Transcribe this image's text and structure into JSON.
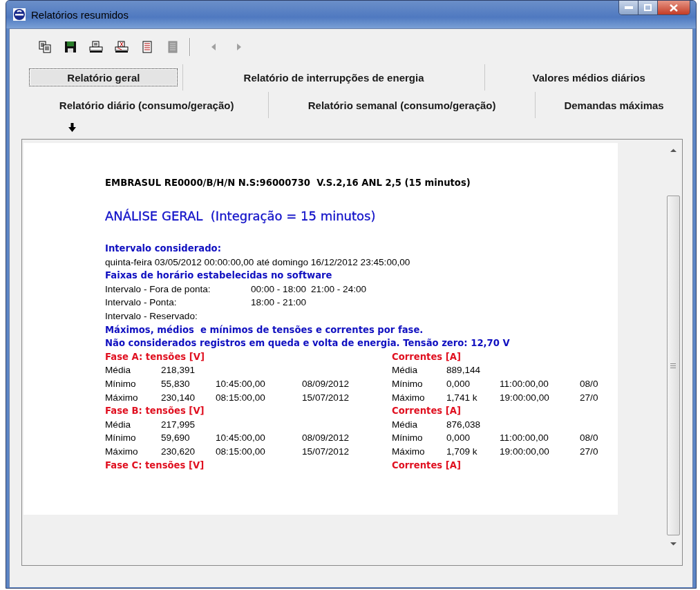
{
  "window": {
    "title": "Relatórios resumidos"
  },
  "toolbar": [
    {
      "kind": "copy",
      "disabled": false
    },
    {
      "kind": "save",
      "disabled": false
    },
    {
      "kind": "print",
      "disabled": false
    },
    {
      "kind": "print-setup",
      "disabled": false
    },
    {
      "kind": "export",
      "disabled": false
    },
    {
      "kind": "export",
      "disabled": true
    },
    {
      "kind": "separator"
    },
    {
      "kind": "prev",
      "disabled": true
    },
    {
      "kind": "next",
      "disabled": true
    }
  ],
  "tab_rows": [
    [
      {
        "label": "Relatório geral",
        "selected": true
      },
      {
        "label": "Relatório de interrupções de energia",
        "selected": false
      },
      {
        "label": "Valores médios diários",
        "selected": false
      }
    ],
    [
      {
        "label": "Relatório diário (consumo/geração)",
        "selected": false
      },
      {
        "label": "Relatório semanal (consumo/geração)",
        "selected": false
      },
      {
        "label": "Demandas máximas",
        "selected": false
      }
    ]
  ],
  "report": [
    {
      "kind": "header",
      "text": "EMBRASUL RE0000/B/H/N N.S:96000730  V.S.2,16 ANL 2,5 (15 minutos)"
    },
    {
      "kind": "title",
      "text": "ANÁLISE GERAL  (Integração = 15 minutos)"
    },
    {
      "kind": "heading",
      "text": "Intervalo considerado:"
    },
    {
      "kind": "text",
      "text": "quinta-feira 03/05/2012 00:00:00,00 até domingo 16/12/2012 23:45:00,00"
    },
    {
      "kind": "heading",
      "text": "Faixas de horário estabelecidas no software"
    },
    {
      "kind": "interval",
      "label": "Intervalo - Fora de ponta:",
      "ranges": [
        "00:00 - 18:00",
        "21:00 - 24:00"
      ]
    },
    {
      "kind": "interval",
      "label": "Intervalo - Ponta:",
      "ranges": [
        "18:00 - 21:00"
      ]
    },
    {
      "kind": "interval",
      "label": "Intervalo - Reservado:"
    },
    {
      "kind": "heading",
      "text": "Máximos, médios  e mínimos de tensões e correntes por fase."
    },
    {
      "kind": "heading",
      "text": "Não considerados registros em queda e volta de energia. Tensão zero: 12,70 V"
    },
    {
      "kind": "phase",
      "left": {
        "title": "Fase A: tensões [V]",
        "rows": [
          {
            "label": "Média",
            "value": "218,391"
          },
          {
            "label": "Mínimo",
            "value": "55,830",
            "time": "10:45:00,00",
            "date": "08/09/2012"
          },
          {
            "label": "Máximo",
            "value": "230,140",
            "time": "08:15:00,00",
            "date": "15/07/2012"
          }
        ]
      },
      "right": {
        "title": "Correntes [A]",
        "rows": [
          {
            "label": "Média",
            "value": "889,144"
          },
          {
            "label": "Mínimo",
            "value": "0,000",
            "time": "11:00:00,00",
            "date": "08/0"
          },
          {
            "label": "Máximo",
            "value": "1,741 k",
            "time": "19:00:00,00",
            "date": "27/0"
          }
        ]
      }
    },
    {
      "kind": "phase",
      "left": {
        "title": "Fase B: tensões [V]",
        "rows": [
          {
            "label": "Média",
            "value": "217,995"
          },
          {
            "label": "Mínimo",
            "value": "59,690",
            "time": "10:45:00,00",
            "date": "08/09/2012"
          },
          {
            "label": "Máximo",
            "value": "230,620",
            "time": "08:15:00,00",
            "date": "15/07/2012"
          }
        ]
      },
      "right": {
        "title": "Correntes [A]",
        "rows": [
          {
            "label": "Média",
            "value": "876,038"
          },
          {
            "label": "Mínimo",
            "value": "0,000",
            "time": "11:00:00,00",
            "date": "08/0"
          },
          {
            "label": "Máximo",
            "value": "1,709 k",
            "time": "19:00:00,00",
            "date": "27/0"
          }
        ]
      }
    },
    {
      "kind": "phase",
      "left": {
        "title": "Fase C: tensões [V]"
      },
      "right": {
        "title": "Correntes [A]"
      }
    }
  ]
}
